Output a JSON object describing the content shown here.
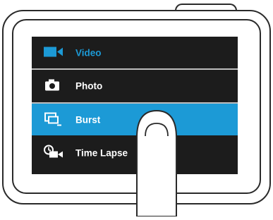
{
  "menu": {
    "items": [
      {
        "label": "Video",
        "icon": "video-camera-icon",
        "state": "active"
      },
      {
        "label": "Photo",
        "icon": "camera-icon",
        "state": "normal"
      },
      {
        "label": "Burst",
        "icon": "burst-icon",
        "state": "selected"
      },
      {
        "label": "Time Lapse",
        "icon": "time-lapse-icon",
        "state": "normal"
      }
    ]
  },
  "colors": {
    "accent": "#1c9ad6",
    "screen_bg": "#1c1c1c",
    "text": "#ffffff",
    "divider": "#bdbdbd"
  }
}
